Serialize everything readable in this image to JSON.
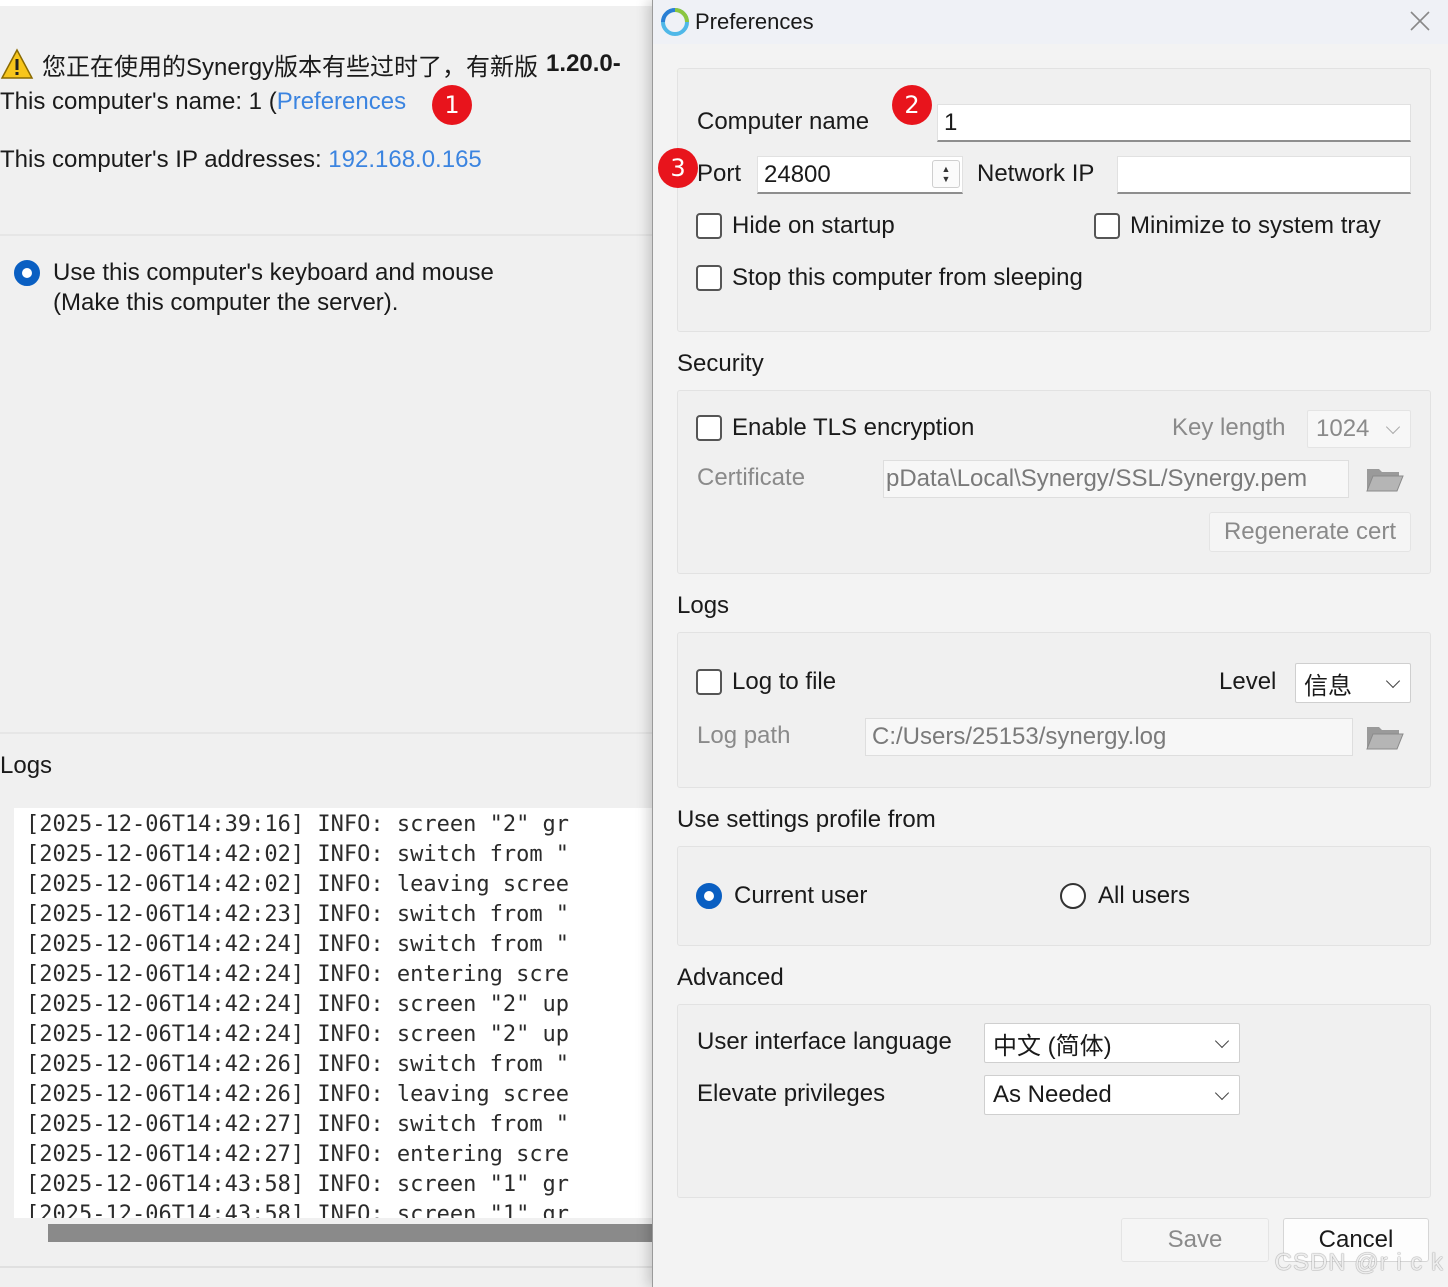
{
  "main": {
    "warning_text": "您正在使用的Synergy版本有些过时了，有新版",
    "warning_version": "1.20.0-",
    "computer_name_prefix": "This computer's name: 1 (",
    "computer_name_link": "Preferences",
    "ip_label": "This computer's IP addresses: ",
    "ip_value": "192.168.0.165",
    "server_option_line1": "Use this computer's keyboard and mouse",
    "server_option_line2": "(Make this computer the server).",
    "logs_title": "Logs",
    "log_lines": [
      "[2025-12-06T14:39:16] INFO: screen \"2\" gr",
      "[2025-12-06T14:42:02] INFO: switch from \"",
      "[2025-12-06T14:42:02] INFO: leaving scree",
      "[2025-12-06T14:42:23] INFO: switch from \"",
      "[2025-12-06T14:42:24] INFO: switch from \"",
      "[2025-12-06T14:42:24] INFO: entering scre",
      "[2025-12-06T14:42:24] INFO: screen \"2\" up",
      "[2025-12-06T14:42:24] INFO: screen \"2\" up",
      "[2025-12-06T14:42:26] INFO: switch from \"",
      "[2025-12-06T14:42:26] INFO: leaving scree",
      "[2025-12-06T14:42:27] INFO: switch from \"",
      "[2025-12-06T14:42:27] INFO: entering scre",
      "[2025-12-06T14:43:58] INFO: screen \"1\" gr",
      "[2025-12-06T14:43:58] INFO: screen \"1\" gr"
    ]
  },
  "badges": {
    "b1": "1",
    "b2": "2",
    "b3": "3"
  },
  "dialog": {
    "title": "Preferences",
    "general": {
      "computer_name_label": "Computer name",
      "computer_name_value": "1",
      "port_label": "Port",
      "port_value": "24800",
      "network_ip_label": "Network IP",
      "network_ip_value": "",
      "hide_on_startup": "Hide on startup",
      "minimize_to_tray": "Minimize to system tray",
      "stop_sleeping": "Stop this computer from sleeping"
    },
    "security": {
      "title": "Security",
      "enable_tls": "Enable TLS encryption",
      "key_length_label": "Key length",
      "key_length_value": "1024",
      "certificate_label": "Certificate",
      "certificate_value": "pData\\Local\\Synergy/SSL/Synergy.pem",
      "regenerate_button": "Regenerate cert"
    },
    "logs": {
      "title": "Logs",
      "log_to_file": "Log to file",
      "level_label": "Level",
      "level_value": "信息",
      "log_path_label": "Log path",
      "log_path_value": "C:/Users/25153/synergy.log"
    },
    "profile": {
      "title": "Use settings profile from",
      "current_user": "Current user",
      "all_users": "All users"
    },
    "advanced": {
      "title": "Advanced",
      "language_label": "User interface language",
      "language_value": "中文 (简体)",
      "elevate_label": "Elevate privileges",
      "elevate_value": "As Needed"
    },
    "buttons": {
      "save": "Save",
      "cancel": "Cancel"
    }
  },
  "watermark": "CSDN @r i c k",
  "colors": {
    "link": "#3b84e0",
    "badge": "#e8141c",
    "radio_selected": "#0a5fc2"
  }
}
